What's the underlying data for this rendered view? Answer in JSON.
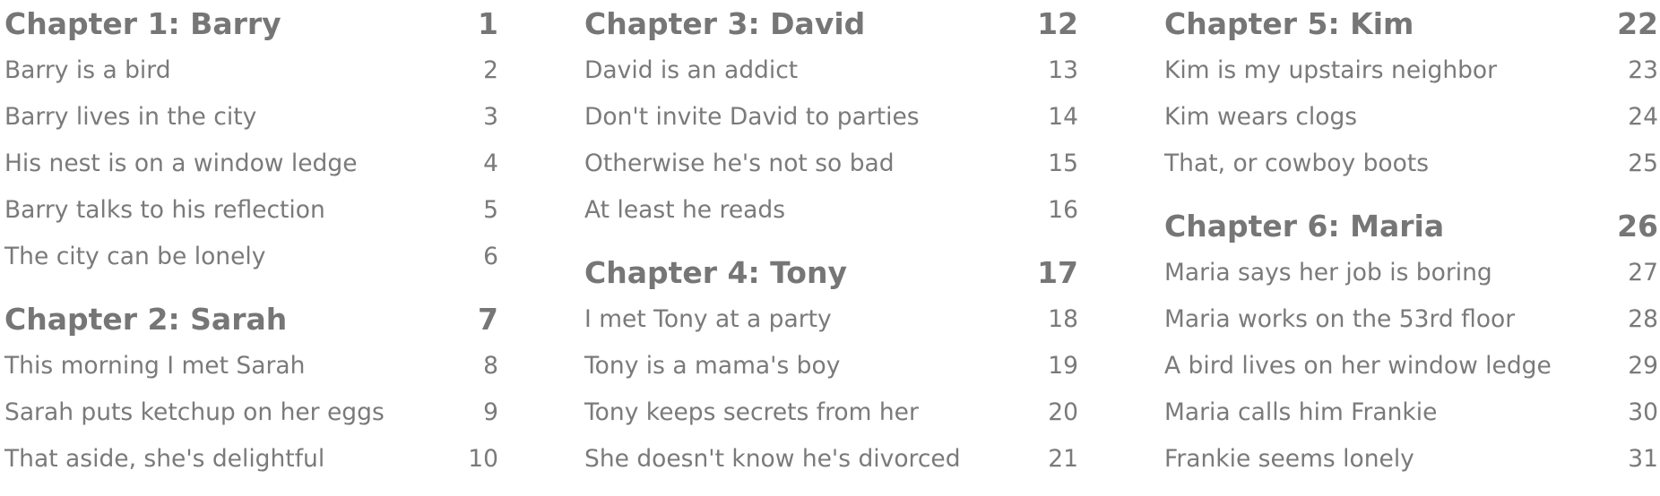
{
  "columns": [
    {
      "chapters": [
        {
          "title": "Chapter 1: Barry",
          "page": "1",
          "items": [
            {
              "text": "Barry is a bird",
              "page": "2"
            },
            {
              "text": "Barry lives in the city",
              "page": "3"
            },
            {
              "text": "His nest is on a window ledge",
              "page": "4"
            },
            {
              "text": "Barry talks to his reflection",
              "page": "5"
            },
            {
              "text": "The city can be lonely",
              "page": "6"
            }
          ]
        },
        {
          "title": "Chapter 2: Sarah",
          "page": "7",
          "items": [
            {
              "text": "This morning I met Sarah",
              "page": "8"
            },
            {
              "text": "Sarah puts ketchup on her eggs",
              "page": "9"
            },
            {
              "text": "That aside, she's delightful",
              "page": "10"
            }
          ]
        }
      ]
    },
    {
      "chapters": [
        {
          "title": "Chapter 3: David",
          "page": "12",
          "items": [
            {
              "text": "David is an addict",
              "page": "13"
            },
            {
              "text": "Don't invite David to parties",
              "page": "14"
            },
            {
              "text": "Otherwise he's not so bad",
              "page": "15"
            },
            {
              "text": "At least he reads",
              "page": "16"
            }
          ]
        },
        {
          "title": "Chapter 4: Tony",
          "page": "17",
          "items": [
            {
              "text": "I met Tony at a party",
              "page": "18"
            },
            {
              "text": "Tony is a mama's boy",
              "page": "19"
            },
            {
              "text": "Tony keeps secrets from her",
              "page": "20"
            },
            {
              "text": "She doesn't know he's divorced",
              "page": "21"
            }
          ]
        }
      ]
    },
    {
      "chapters": [
        {
          "title": "Chapter 5: Kim",
          "page": "22",
          "items": [
            {
              "text": "Kim is my upstairs neighbor",
              "page": "23"
            },
            {
              "text": "Kim wears clogs",
              "page": "24"
            },
            {
              "text": "That, or cowboy boots",
              "page": "25"
            }
          ]
        },
        {
          "title": "Chapter 6: Maria",
          "page": "26",
          "items": [
            {
              "text": "Maria says her job is boring",
              "page": "27"
            },
            {
              "text": "Maria works on the 53rd floor",
              "page": "28"
            },
            {
              "text": "A bird lives on her window ledge",
              "page": "29"
            },
            {
              "text": "Maria calls him Frankie",
              "page": "30"
            },
            {
              "text": "Frankie seems lonely",
              "page": "31"
            }
          ]
        }
      ]
    }
  ]
}
